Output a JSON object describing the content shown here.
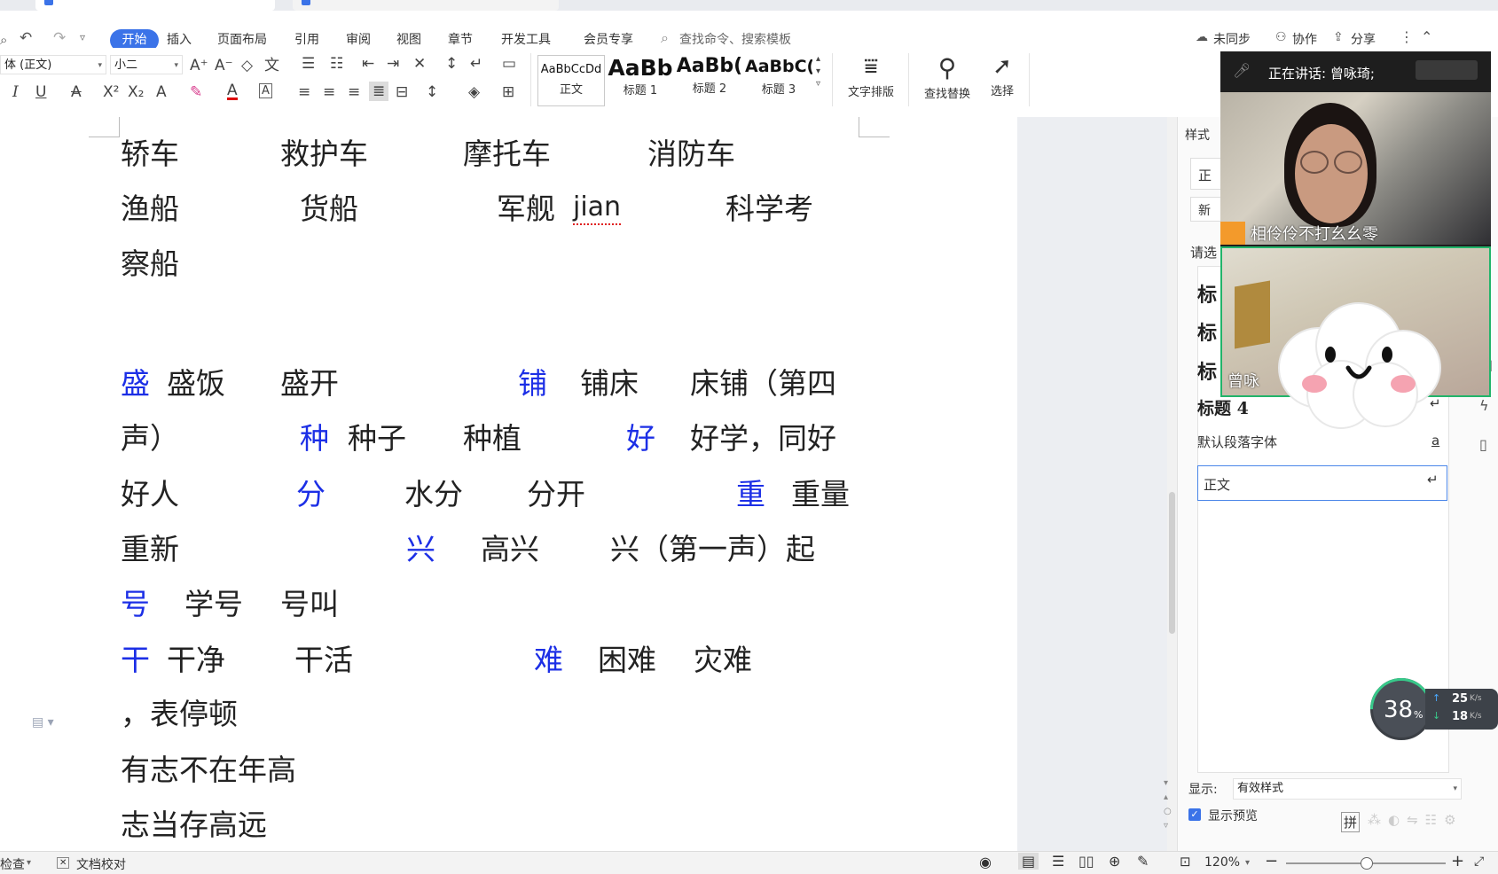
{
  "menu": {
    "items": [
      "开始",
      "插入",
      "页面布局",
      "引用",
      "审阅",
      "视图",
      "章节",
      "开发工具",
      "会员专享"
    ],
    "search_placeholder": "查找命令、搜索模板",
    "right": [
      "未同步",
      "协作",
      "分享"
    ]
  },
  "ribbon": {
    "font_name": "体 (正文)",
    "font_size": "小二",
    "styles": [
      {
        "preview": "AaBbCcDd",
        "label": "正文"
      },
      {
        "preview": "AaBb",
        "label": "标题 1"
      },
      {
        "preview": "AaBb(",
        "label": "标题 2"
      },
      {
        "preview": "AaBbC(",
        "label": "标题 3"
      }
    ],
    "text_layout": "文字排版",
    "find_replace": "查找替换",
    "select": "选择"
  },
  "document": {
    "line1": [
      "轿车",
      "救护车",
      "摩托车",
      "消防车"
    ],
    "line2": [
      "渔船",
      "货船",
      "军舰",
      "jian",
      "科学考"
    ],
    "line3": "察船",
    "line4": [
      "盛",
      "盛饭",
      "盛开",
      "铺",
      "铺床",
      "床铺（第四"
    ],
    "line5": [
      "声）",
      "种",
      "种子",
      "种植",
      "好",
      "好学，同好"
    ],
    "line6": [
      "好人",
      "分",
      "水分",
      "分开",
      "重",
      "重量"
    ],
    "line7": [
      "重新",
      "兴",
      "高兴",
      "兴（第一声）起"
    ],
    "line8": [
      "号",
      "学号",
      "号叫"
    ],
    "line9": [
      "干",
      "干净",
      "干活",
      "难",
      "困难",
      "灾难"
    ],
    "line10": "，表停顿",
    "line11": "有志不在年高",
    "line12": "志当存高远"
  },
  "pane": {
    "title_fragment": "样式",
    "choose_fragment": "请选",
    "input_fragment1": "正",
    "input_fragment2": "新",
    "style_rows": [
      "标",
      "标",
      "标",
      "标题 4"
    ],
    "default_font": "默认段落字体",
    "default_font_marker": "a",
    "normal_style": "正文",
    "display_label": "显示:",
    "display_value": "有效样式",
    "show_preview": "显示预览"
  },
  "call": {
    "speaking": "正在讲话: 曾咏琦;",
    "user1": "相伶伶不打幺幺零",
    "user2": "曾咏"
  },
  "speed": {
    "percent": "38",
    "percent_unit": "%",
    "up": "25",
    "down": "18",
    "unit": "K/s"
  },
  "status": {
    "spell": "检查",
    "proof": "文档校对",
    "zoom": "120%"
  },
  "colors": {
    "accent": "#3b73e8",
    "highlight_char": "#1c2fe6"
  }
}
